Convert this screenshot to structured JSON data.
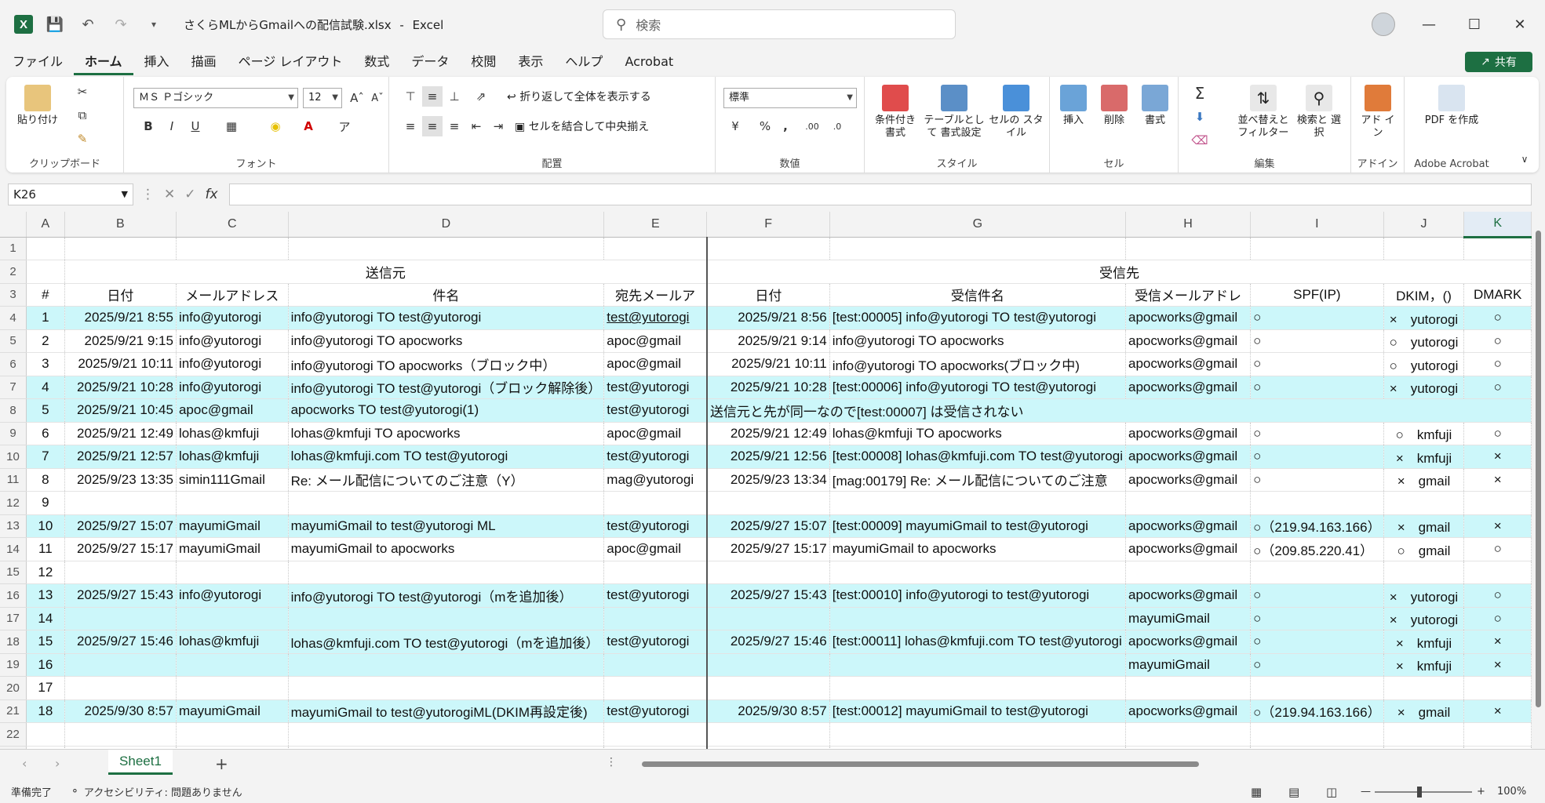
{
  "titlebar": {
    "filename": "さくらMLからGmailへの配信試験.xlsx",
    "separator": "-",
    "app": "Excel",
    "search_placeholder": "検索"
  },
  "tabs": [
    "ファイル",
    "ホーム",
    "挿入",
    "描画",
    "ページ レイアウト",
    "数式",
    "データ",
    "校閲",
    "表示",
    "ヘルプ",
    "Acrobat"
  ],
  "share_label": "共有",
  "ribbon": {
    "clipboard": {
      "paste": "貼り付け",
      "label": "クリップボード"
    },
    "font": {
      "name": "ＭＳ Ｐゴシック",
      "size": "12",
      "label": "フォント",
      "bold": "B",
      "italic": "I",
      "underline": "U"
    },
    "alignment": {
      "wrap": "折り返して全体を表示する",
      "merge": "セルを結合して中央揃え",
      "label": "配置"
    },
    "number": {
      "format": "標準",
      "percent": "%",
      "comma": ",",
      "label": "数値"
    },
    "styles": {
      "cond": "条件付き 書式",
      "table": "テーブルとして 書式設定",
      "cell": "セルの スタイル",
      "label": "スタイル"
    },
    "cells": {
      "insert": "挿入",
      "delete": "削除",
      "format": "書式",
      "label": "セル"
    },
    "editing": {
      "sort": "並べ替えと フィルター",
      "find": "検索と 選択",
      "label": "編集"
    },
    "addins": {
      "addin": "アド イン",
      "label": "アドイン"
    },
    "acrobat": {
      "pdf": "PDF を作成",
      "label": "Adobe Acrobat"
    }
  },
  "formula": {
    "namebox": "K26",
    "fx": "fx"
  },
  "columns": [
    "A",
    "B",
    "C",
    "D",
    "E",
    "F",
    "G",
    "H",
    "I",
    "J",
    "K"
  ],
  "headers": {
    "sender": "送信元",
    "receiver": "受信先",
    "num": "#",
    "date": "日付",
    "mail": "メールアドレス",
    "subject": "件名",
    "to": "宛先メールア",
    "rdate": "日付",
    "rsubject": "受信件名",
    "rmail": "受信メールアドレ",
    "spf": "SPF(IP)",
    "dkim": "DKIM，()",
    "dmark": "DMARK"
  },
  "rows": [
    {
      "r": "4",
      "hl": true,
      "a": "1",
      "b": "2025/9/21 8:55",
      "c": "info@yutorogi",
      "d": "info@yutorogi TO test@yutorogi",
      "e": "test@yutorogi",
      "elink": true,
      "f": "2025/9/21 8:56",
      "g": "[test:00005] info@yutorogi TO test@yutorogi",
      "h": "apocworks@gmail",
      "i": "○",
      "j": "×　yutorogi",
      "k": "○"
    },
    {
      "r": "5",
      "hl": false,
      "a": "2",
      "b": "2025/9/21 9:15",
      "c": "info@yutorogi",
      "d": "info@yutorogi TO apocworks",
      "e": "apoc@gmail",
      "f": "2025/9/21 9:14",
      "g": "info@yutorogi TO apocworks",
      "h": "apocworks@gmail",
      "i": "○",
      "j": "○　yutorogi",
      "k": "○"
    },
    {
      "r": "6",
      "hl": false,
      "a": "3",
      "b": "2025/9/21 10:11",
      "c": "info@yutorogi",
      "d": "info@yutorogi TO apocworks（ブロック中）",
      "e": "apoc@gmail",
      "f": "2025/9/21 10:11",
      "g": "info@yutorogi TO apocworks(ブロック中)",
      "h": "apocworks@gmail",
      "i": "○",
      "j": "○　yutorogi",
      "k": "○"
    },
    {
      "r": "7",
      "hl": true,
      "a": "4",
      "b": "2025/9/21 10:28",
      "c": "info@yutorogi",
      "d": "info@yutorogi TO test@yutorogi（ブロック解除後）",
      "e": "test@yutorogi",
      "f": "2025/9/21 10:28",
      "g": "[test:00006] info@yutorogi TO test@yutorogi",
      "h": "apocworks@gmail",
      "i": "○",
      "j": "×　yutorogi",
      "k": "○"
    },
    {
      "r": "8",
      "hl": true,
      "a": "5",
      "b": "2025/9/21 10:45",
      "c": "apoc@gmail",
      "d": "apocworks TO test@yutorogi(1)",
      "e": "test@yutorogi",
      "note": "送信元と先が同一なので[test:00007] は受信されない"
    },
    {
      "r": "9",
      "hl": false,
      "a": "6",
      "b": "2025/9/21 12:49",
      "c": "lohas@kmfuji",
      "d": "lohas@kmfuji TO apocworks",
      "e": "apoc@gmail",
      "f": "2025/9/21 12:49",
      "g": "lohas@kmfuji TO apocworks",
      "h": "apocworks@gmail",
      "i": "○",
      "j": "○　kmfuji",
      "k": "○"
    },
    {
      "r": "10",
      "hl": true,
      "a": "7",
      "b": "2025/9/21 12:57",
      "c": "lohas@kmfuji",
      "d": "lohas@kmfuji.com TO test@yutorogi",
      "e": "test@yutorogi",
      "f": "2025/9/21 12:56",
      "g": "[test:00008] lohas@kmfuji.com TO test@yutorogi",
      "h": "apocworks@gmail",
      "i": "○",
      "j": "×　kmfuji",
      "k": "×"
    },
    {
      "r": "11",
      "hl": false,
      "a": "8",
      "b": "2025/9/23 13:35",
      "c": "simin111Gmail",
      "d": "Re: メール配信についてのご注意（Y）",
      "e": "mag@yutorogi",
      "f": "2025/9/23 13:34",
      "g": "[mag:00179] Re: メール配信についてのご注意",
      "h": "apocworks@gmail",
      "i": "○",
      "j": "×　gmail",
      "k": "×"
    },
    {
      "r": "12",
      "hl": false,
      "a": "9"
    },
    {
      "r": "13",
      "hl": true,
      "a": "10",
      "b": "2025/9/27 15:07",
      "c": "mayumiGmail",
      "d": "mayumiGmail to test@yutorogi ML",
      "e": "test@yutorogi",
      "f": "2025/9/27 15:07",
      "g": "[test:00009] mayumiGmail to test@yutorogi",
      "h": "apocworks@gmail",
      "i": "○（219.94.163.166）",
      "j": "×　gmail",
      "k": "×"
    },
    {
      "r": "14",
      "hl": false,
      "a": "11",
      "b": "2025/9/27 15:17",
      "c": "mayumiGmail",
      "d": "mayumiGmail to apocworks",
      "e": "apoc@gmail",
      "f": "2025/9/27 15:17",
      "g": "mayumiGmail to apocworks",
      "h": "apocworks@gmail",
      "i": "○（209.85.220.41）",
      "j": "○　gmail",
      "k": "○"
    },
    {
      "r": "15",
      "hl": false,
      "a": "12"
    },
    {
      "r": "16",
      "hl": true,
      "a": "13",
      "b": "2025/9/27 15:43",
      "c": "info@yutorogi",
      "d": "info@yutorogi TO test@yutorogi（mを追加後）",
      "e": "test@yutorogi",
      "f": "2025/9/27 15:43",
      "g": "[test:00010] info@yutorogi to test@yutorogi",
      "h": "apocworks@gmail",
      "i": "○",
      "j": "×　yutorogi",
      "k": "○"
    },
    {
      "r": "17",
      "hl": true,
      "a": "14",
      "h": "mayumiGmail",
      "i": "○",
      "j": "×　yutorogi",
      "k": "○"
    },
    {
      "r": "18",
      "hl": true,
      "a": "15",
      "b": "2025/9/27 15:46",
      "c": "lohas@kmfuji",
      "d": "lohas@kmfuji.com TO test@yutorogi（mを追加後）",
      "e": "test@yutorogi",
      "f": "2025/9/27 15:46",
      "g": "[test:00011] lohas@kmfuji.com TO test@yutorogi",
      "h": "apocworks@gmail",
      "i": "○",
      "j": "×　kmfuji",
      "k": "×"
    },
    {
      "r": "19",
      "hl": true,
      "a": "16",
      "h": "mayumiGmail",
      "i": "○",
      "j": "×　kmfuji",
      "k": "×"
    },
    {
      "r": "20",
      "hl": false,
      "a": "17"
    },
    {
      "r": "21",
      "hl": true,
      "a": "18",
      "b": "2025/9/30 8:57",
      "c": "mayumiGmail",
      "d": "mayumiGmail to test@yutorogiML(DKIM再設定後)",
      "e": "test@yutorogi",
      "f": "2025/9/30 8:57",
      "g": "[test:00012] mayumiGmail to test@yutorogi",
      "h": "apocworks@gmail",
      "i": "○（219.94.163.166）",
      "j": "×　gmail",
      "k": "×"
    },
    {
      "r": "22",
      "hl": false
    },
    {
      "r": "23",
      "hl": false
    }
  ],
  "sheet_tab": "Sheet1",
  "add_sheet": "+",
  "status": {
    "ready": "準備完了",
    "accessibility": "アクセシビリティ: 問題ありません",
    "zoom": "100%"
  },
  "colors": {
    "excel_green": "#1d6f42",
    "highlight": "#ccf7fa",
    "link": "#3a8ea8"
  }
}
